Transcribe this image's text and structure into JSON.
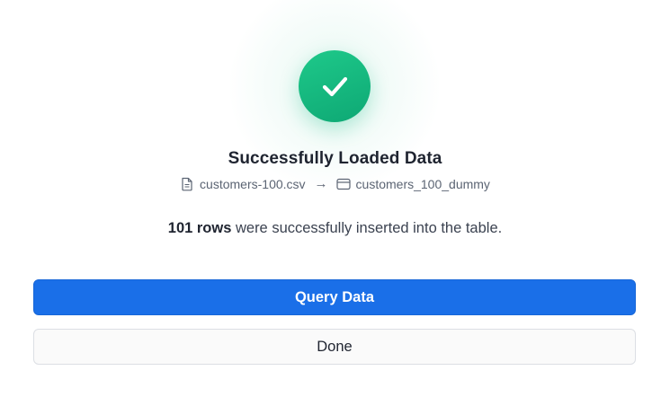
{
  "dialog": {
    "title": "Successfully Loaded Data",
    "source_file": "customers-100.csv",
    "arrow": "→",
    "target_table": "customers_100_dummy",
    "row_count_text": "101 rows",
    "summary_rest": " were successfully inserted into the table."
  },
  "actions": {
    "primary_label": "Query Data",
    "secondary_label": "Done"
  },
  "icons": {
    "status": "check-icon",
    "source": "file-icon",
    "target": "table-icon"
  },
  "colors": {
    "success": "#10b981",
    "primary": "#1a6fe8"
  }
}
